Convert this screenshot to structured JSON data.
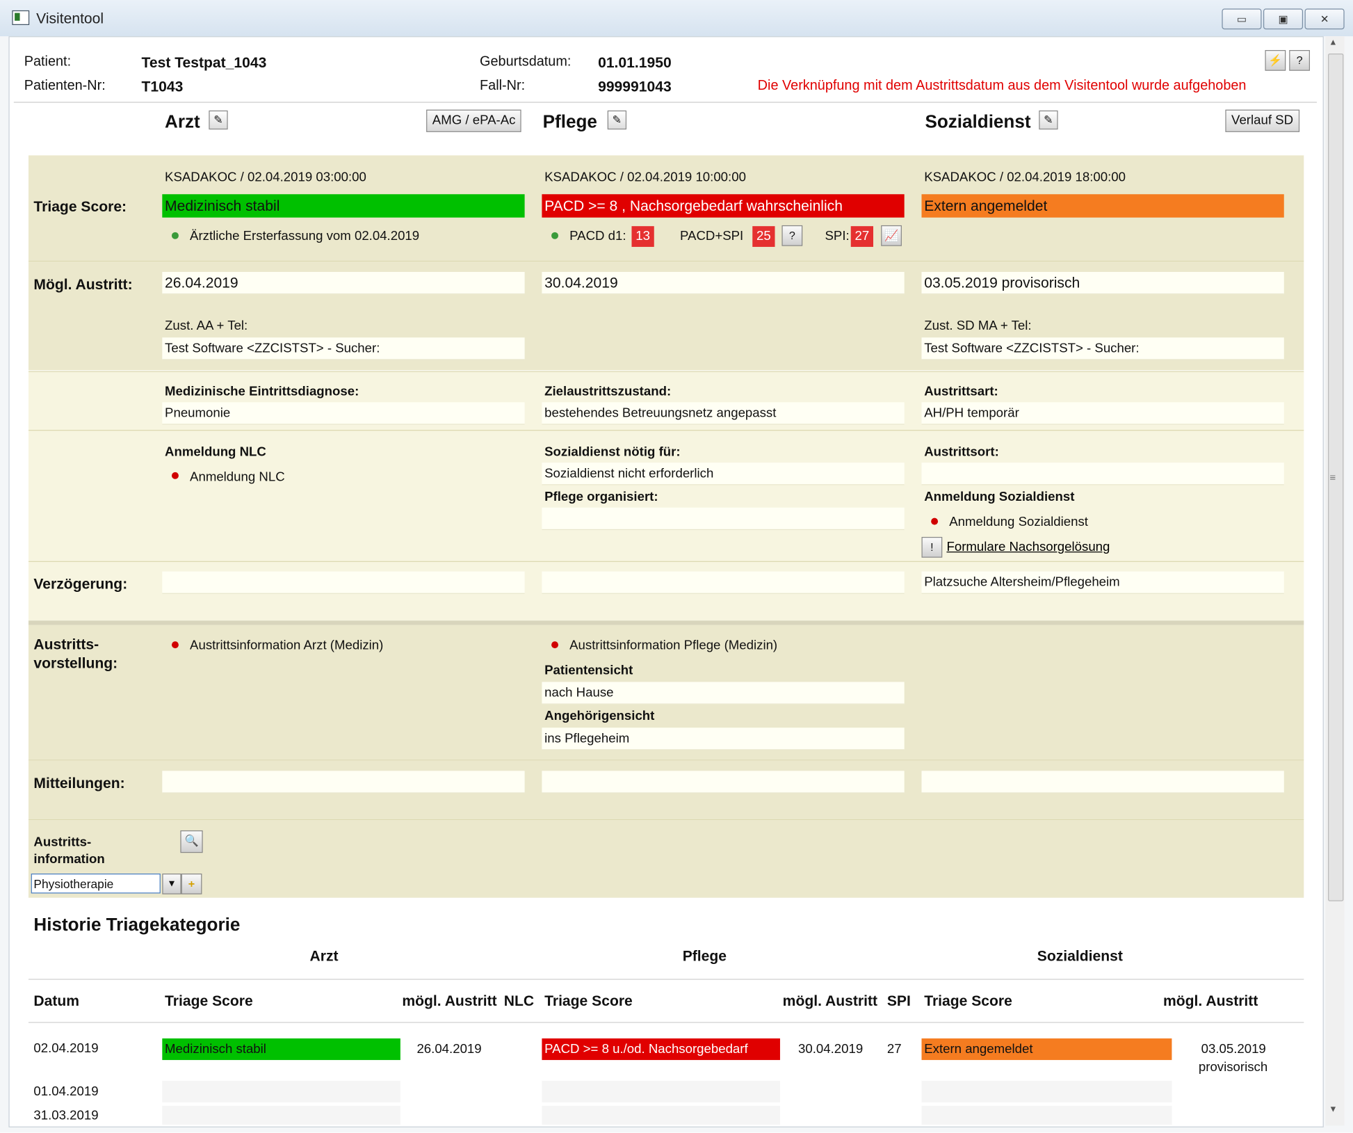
{
  "window": {
    "title": "Visitentool",
    "minimize": "▭",
    "maximize": "▣",
    "close": "✕"
  },
  "patient": {
    "patient_label": "Patient:",
    "patient_value": "Test Testpat_1043",
    "nr_label": "Patienten-Nr:",
    "nr_value": "T1043",
    "birth_label": "Geburtsdatum:",
    "birth_value": "01.01.1950",
    "fall_label": "Fall-Nr:",
    "fall_value": "999991043",
    "warning": "Die Verknüpfung mit dem Austrittsdatum aus dem Visitentool wurde aufgehoben",
    "warning_color": "#e00000"
  },
  "columns": {
    "arzt": "Arzt",
    "pflege": "Pflege",
    "sozialdienst": "Sozialdienst",
    "amg_button": "AMG / ePA-Ac",
    "verlauf_button": "Verlauf SD"
  },
  "triage": {
    "label": "Triage Score:",
    "arzt": {
      "meta": "KSADAKOC / 02.04.2019 03:00:00",
      "status": "Medizinisch stabil",
      "status_color": "#00c000",
      "note": "Ärztliche Ersterfassung vom 02.04.2019"
    },
    "pflege": {
      "meta": "KSADAKOC / 02.04.2019 10:00:00",
      "status": "PACD >= 8 , Nachsorgebedarf wahrscheinlich",
      "status_color": "#e00000",
      "pacd_label": "PACD d1:",
      "pacd_value": "13",
      "pacdspi_label": "PACD+SPI",
      "pacdspi_value": "25",
      "spi_label": "SPI:",
      "spi_value": "27"
    },
    "sozial": {
      "meta": "KSADAKOC / 02.04.2019 18:00:00",
      "status": "Extern angemeldet",
      "status_color": "#f57c20"
    }
  },
  "austritt": {
    "label": "Mögl. Austritt:",
    "arzt_date": "26.04.2019",
    "pflege_date": "30.04.2019",
    "sozial_date": "03.05.2019  provisorisch",
    "arzt_zust_label": "Zust. AA + Tel:",
    "arzt_zust_value": "Test Software <ZZCISTST> - Sucher:",
    "sozial_zust_label": "Zust. SD MA + Tel:",
    "sozial_zust_value": "Test Software <ZZCISTST> - Sucher:"
  },
  "diagnose": {
    "arzt_label": "Medizinische Eintrittsdiagnose:",
    "arzt_value": "Pneumonie",
    "pflege_label": "Zielaustrittszustand:",
    "pflege_value": "bestehendes Betreuungsnetz angepasst",
    "sozial_label": "Austrittsart:",
    "sozial_value": "AH/PH temporär"
  },
  "nlc": {
    "arzt_label": "Anmeldung NLC",
    "arzt_item": "Anmeldung NLC",
    "pflege_label1": "Sozialdienst nötig für:",
    "pflege_value1": "Sozialdienst nicht erforderlich",
    "pflege_label2": "Pflege organisiert:",
    "pflege_value2": "",
    "sozial_label1": "Austrittsort:",
    "sozial_value1": "",
    "sozial_label2": "Anmeldung Sozialdienst",
    "sozial_item": "Anmeldung Sozialdienst",
    "formular_link": "Formulare Nachsorgelösung"
  },
  "verzoegerung": {
    "label": "Verzögerung:",
    "arzt": "",
    "pflege": "",
    "sozial": "Platzsuche Altersheim/Pflegeheim"
  },
  "vorstellung": {
    "label1": "Austritts-",
    "label2": "vorstellung:",
    "arzt_item": "Austrittsinformation Arzt (Medizin)",
    "pflege_item": "Austrittsinformation Pflege (Medizin)",
    "patientensicht_label": "Patientensicht",
    "patientensicht_value": "nach Hause",
    "angehoerigen_label": "Angehörigensicht",
    "angehoerigen_value": "ins Pflegeheim"
  },
  "mitteilungen": {
    "label": "Mitteilungen:"
  },
  "austrittsinfo": {
    "label1": "Austritts-",
    "label2": "information",
    "select_value": "Physiotherapie"
  },
  "historie": {
    "title": "Historie Triagekategorie",
    "group_arzt": "Arzt",
    "group_pflege": "Pflege",
    "group_sozial": "Sozialdienst",
    "headers": {
      "datum": "Datum",
      "arzt_score": "Triage Score",
      "arzt_austritt": "mögl. Austritt",
      "nlc": "NLC",
      "pflege_score": "Triage Score",
      "pflege_austritt": "mögl. Austritt",
      "spi": "SPI",
      "sozial_score": "Triage Score",
      "sozial_austritt": "mögl. Austritt"
    },
    "rows": [
      {
        "datum": "02.04.2019",
        "arzt_score": "Medizinisch stabil",
        "arzt_austritt": "26.04.2019",
        "pflege_score": "PACD >= 8 u./od. Nachsorgebedarf",
        "pflege_austritt": "30.04.2019",
        "spi": "27",
        "sozial_score": "Extern angemeldet",
        "sozial_austritt": "03.05.2019",
        "sozial_austritt2": "provisorisch"
      },
      {
        "datum": "01.04.2019"
      },
      {
        "datum": "31.03.2019"
      }
    ]
  }
}
